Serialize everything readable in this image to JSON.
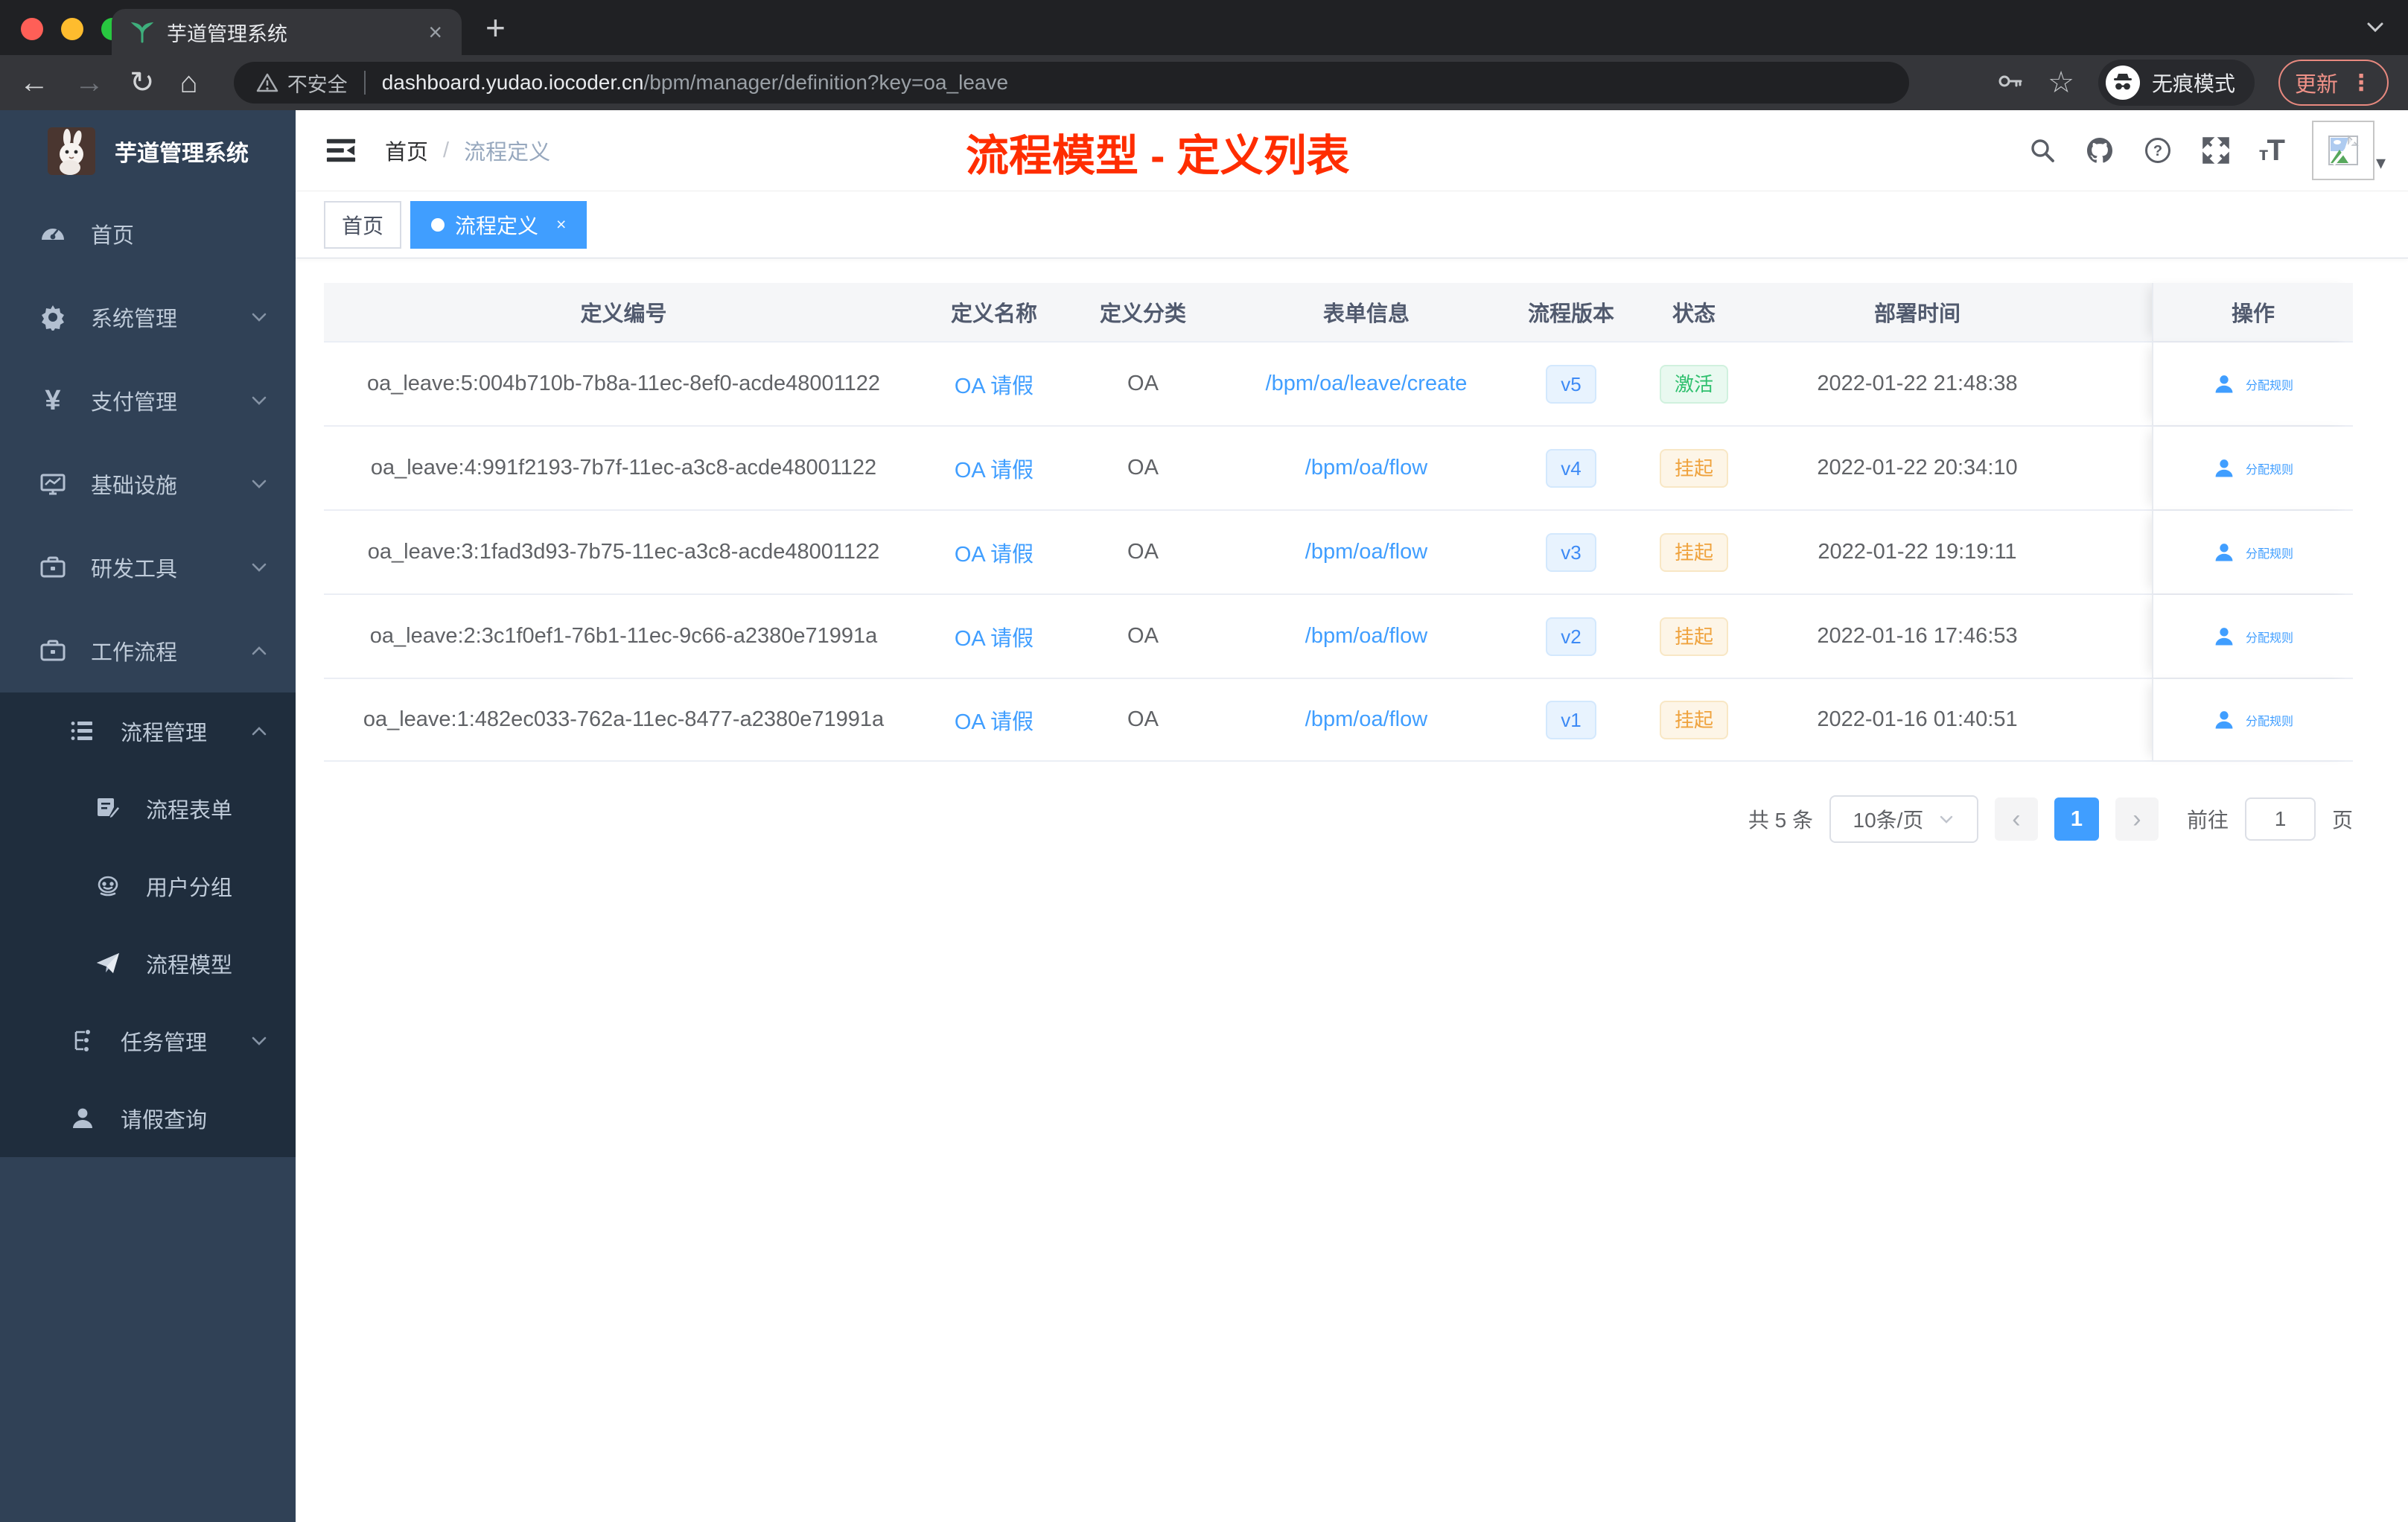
{
  "colors": {
    "accent_blue": "#409eff",
    "annotation_red": "#ff2d00",
    "sidebar_bg": "#304156",
    "sidebar_submenu_bg": "#1f2d3d",
    "success_green": "#2fc06e",
    "warning_orange": "#efa23c"
  },
  "chrome": {
    "tab_title": "芋道管理系统",
    "tab_close": "×",
    "new_tab_button": "+",
    "back_icon": "←",
    "forward_icon": "→",
    "reload_icon": "↻",
    "home_icon": "⌂",
    "security_label": "不安全",
    "url_host": "dashboard.yudao.iocoder.cn",
    "url_path": "/bpm/manager/definition?key=oa_leave",
    "star_icon": "☆",
    "incognito_label": "无痕模式",
    "update_label": "更新",
    "menu_dots": "⋮",
    "caret": "▾"
  },
  "sidebar": {
    "logo_title": "芋道管理系统",
    "yen_glyph": "¥",
    "items": [
      {
        "label": "首页"
      },
      {
        "label": "系统管理"
      },
      {
        "label": "支付管理"
      },
      {
        "label": "基础设施"
      },
      {
        "label": "研发工具"
      },
      {
        "label": "工作流程"
      }
    ],
    "submenu": [
      {
        "label": "流程管理"
      },
      {
        "label": "流程表单"
      },
      {
        "label": "用户分组"
      },
      {
        "label": "流程模型"
      },
      {
        "label": "任务管理"
      },
      {
        "label": "请假查询"
      }
    ]
  },
  "navbar": {
    "breadcrumb_home": "首页",
    "breadcrumb_separator": "/",
    "breadcrumb_current": "流程定义",
    "annotation": "流程模型 - 定义列表"
  },
  "tags": {
    "home_label": "首页",
    "active_label": "流程定义",
    "close": "×"
  },
  "table": {
    "headers": [
      "定义编号",
      "定义名称",
      "定义分类",
      "表单信息",
      "流程版本",
      "状态",
      "部署时间",
      "操作"
    ],
    "action_label": "分配规则",
    "rows": [
      {
        "id": "oa_leave:5:004b710b-7b8a-11ec-8ef0-acde48001122",
        "name": "OA 请假",
        "category": "OA",
        "form": "/bpm/oa/leave/create",
        "version": "v5",
        "status": "激活",
        "deployed": "2022-01-22 21:48:38"
      },
      {
        "id": "oa_leave:4:991f2193-7b7f-11ec-a3c8-acde48001122",
        "name": "OA 请假",
        "category": "OA",
        "form": "/bpm/oa/flow",
        "version": "v4",
        "status": "挂起",
        "deployed": "2022-01-22 20:34:10"
      },
      {
        "id": "oa_leave:3:1fad3d93-7b75-11ec-a3c8-acde48001122",
        "name": "OA 请假",
        "category": "OA",
        "form": "/bpm/oa/flow",
        "version": "v3",
        "status": "挂起",
        "deployed": "2022-01-22 19:19:11"
      },
      {
        "id": "oa_leave:2:3c1f0ef1-76b1-11ec-9c66-a2380e71991a",
        "name": "OA 请假",
        "category": "OA",
        "form": "/bpm/oa/flow",
        "version": "v2",
        "status": "挂起",
        "deployed": "2022-01-16 17:46:53"
      },
      {
        "id": "oa_leave:1:482ec033-762a-11ec-8477-a2380e71991a",
        "name": "OA 请假",
        "category": "OA",
        "form": "/bpm/oa/flow",
        "version": "v1",
        "status": "挂起",
        "deployed": "2022-01-16 01:40:51"
      }
    ]
  },
  "pagination": {
    "total_label": "共 5 条",
    "page_size_label": "10条/页",
    "prev_icon": "‹",
    "current_page": "1",
    "next_icon": "›",
    "goto_label": "前往",
    "goto_value": "1",
    "goto_unit_label": "页"
  }
}
